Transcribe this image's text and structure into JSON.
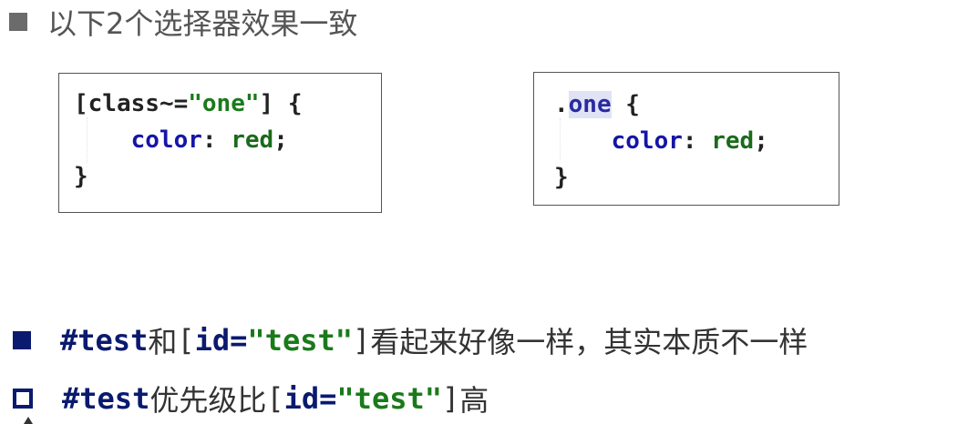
{
  "heading": {
    "text": "以下2个选择器效果一致"
  },
  "code_left": {
    "line1_open_bracket": "[",
    "line1_attr": "class",
    "line1_op": "~=",
    "line1_value": "\"one\"",
    "line1_close": "] {",
    "line2_indent": "    ",
    "line2_prop": "color",
    "line2_colon": ": ",
    "line2_value": "red",
    "line2_semi": ";",
    "line3": "}"
  },
  "code_right": {
    "line1_dot": ".",
    "line1_selector": "one",
    "line1_open": " {",
    "line2_indent": "    ",
    "line2_prop": "color",
    "line2_colon": ": ",
    "line2_value": "red",
    "line2_semi": ";",
    "line3": "}"
  },
  "bullets": [
    {
      "part1": "#test",
      "part2": "和",
      "part3": "[",
      "part4": "id=",
      "part5": "\"test\"",
      "part6": "]",
      "part7": "看起来好像一样，其实本质不一样"
    },
    {
      "part1": "#test",
      "part2": "优先级比",
      "part3": "[",
      "part4": "id=",
      "part5": "\"test\"",
      "part6": "]",
      "part7": "高"
    }
  ]
}
